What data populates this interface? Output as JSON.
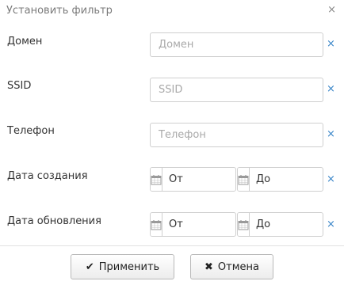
{
  "dialog": {
    "title": "Установить фильтр",
    "close_glyph": "×"
  },
  "fields": {
    "domain": {
      "label": "Домен",
      "placeholder": "Домен",
      "value": ""
    },
    "ssid": {
      "label": "SSID",
      "placeholder": "SSID",
      "value": ""
    },
    "phone": {
      "label": "Телефон",
      "placeholder": "Телефон",
      "value": ""
    },
    "created": {
      "label": "Дата создания",
      "from_placeholder": "От",
      "to_placeholder": "До"
    },
    "updated": {
      "label": "Дата обновления",
      "from_placeholder": "От",
      "to_placeholder": "До"
    }
  },
  "clear_glyph": "×",
  "buttons": {
    "apply": {
      "label": "Применить",
      "icon": "check-icon",
      "glyph": "✔"
    },
    "cancel": {
      "label": "Отмена",
      "icon": "close-icon",
      "glyph": "✖"
    }
  },
  "colors": {
    "clear_x": "#3a86c8",
    "border": "#cfcfcf"
  }
}
